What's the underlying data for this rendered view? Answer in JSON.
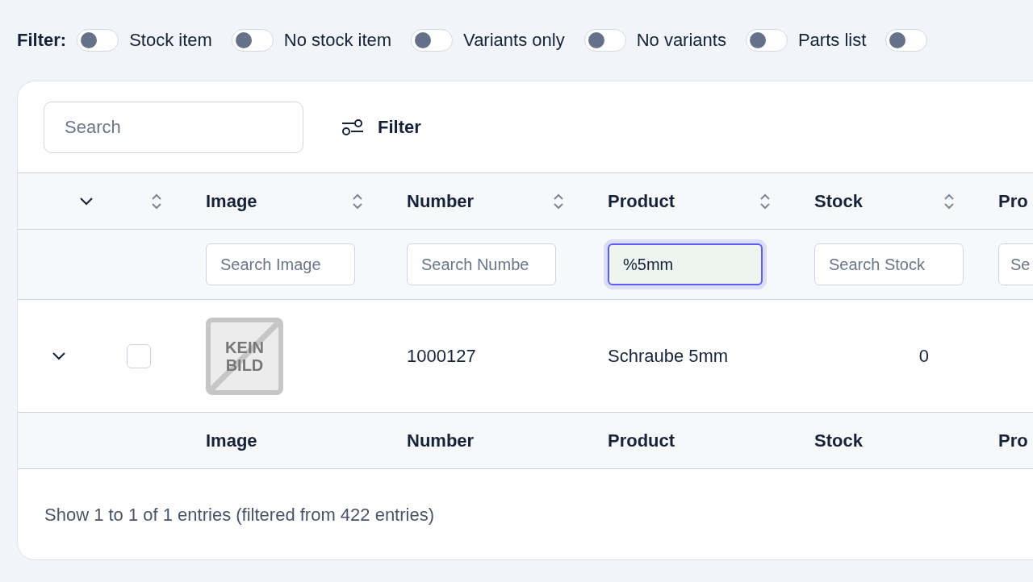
{
  "filter_bar": {
    "label": "Filter:",
    "toggles": [
      {
        "label": "Stock item",
        "on": false
      },
      {
        "label": "No stock item",
        "on": false
      },
      {
        "label": "Variants only",
        "on": false
      },
      {
        "label": "No variants",
        "on": false
      },
      {
        "label": "Parts list",
        "on": false
      },
      {
        "on": false
      }
    ]
  },
  "toolbar": {
    "search": {
      "placeholder": "Search"
    },
    "filter_button": "Filter"
  },
  "table": {
    "columns": [
      {
        "kind": "expand"
      },
      {
        "kind": "select",
        "sortable": true
      },
      {
        "kind": "data",
        "label": "Image",
        "sortable": true,
        "search": {
          "placeholder": "Search Image",
          "focused": false
        }
      },
      {
        "kind": "data",
        "label": "Number",
        "sortable": true,
        "search": {
          "placeholder": "Search Numbe",
          "focused": false
        }
      },
      {
        "kind": "data",
        "label": "Product",
        "sortable": true,
        "search": {
          "value": "%5mm",
          "focused": true
        }
      },
      {
        "kind": "data",
        "label": "Stock",
        "sortable": true,
        "search": {
          "placeholder": "Search Stock",
          "focused": false
        }
      },
      {
        "kind": "data",
        "label": "Pro",
        "sortable": false,
        "search": {
          "placeholder": "Se",
          "focused": false
        }
      }
    ],
    "rows": [
      {
        "expanded": false,
        "selected": false,
        "cells": [
          {
            "kind": "expand"
          },
          {
            "kind": "select"
          },
          {
            "kind": "image",
            "text": "KEIN BILD"
          },
          {
            "kind": "text",
            "text": "1000127"
          },
          {
            "kind": "text",
            "text": "Schraube 5mm"
          },
          {
            "kind": "number",
            "text": "0"
          }
        ]
      }
    ],
    "footer_labels": [
      "Image",
      "Number",
      "Product",
      "Stock",
      "Pro"
    ]
  },
  "info": "Show 1 to 1 of 1 entries (filtered from 422 entries)"
}
